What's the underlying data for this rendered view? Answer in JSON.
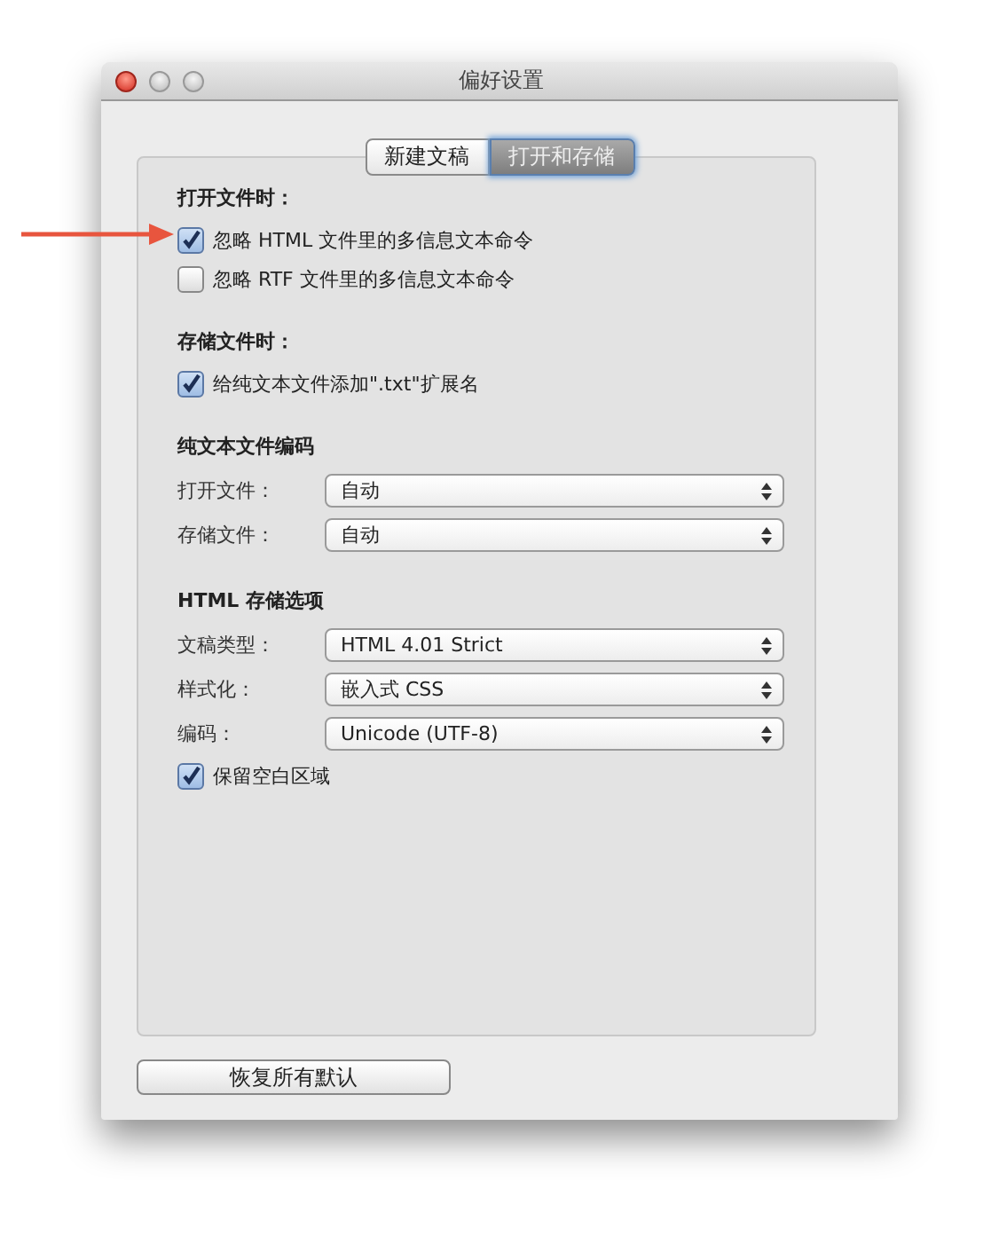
{
  "window": {
    "title": "偏好设置"
  },
  "tabs": [
    {
      "label": "新建文稿",
      "selected": false
    },
    {
      "label": "打开和存储",
      "selected": true
    }
  ],
  "sections": [
    {
      "heading": "打开文件时：",
      "items": [
        {
          "kind": "checkbox",
          "label": "忽略 HTML 文件里的多信息文本命令",
          "checked": true
        },
        {
          "kind": "checkbox",
          "label": "忽略 RTF 文件里的多信息文本命令",
          "checked": false
        }
      ]
    },
    {
      "heading": "存储文件时：",
      "items": [
        {
          "kind": "checkbox",
          "label": "给纯文本文件添加\".txt\"扩展名",
          "checked": true
        }
      ]
    },
    {
      "heading": "纯文本文件编码",
      "items": [
        {
          "kind": "select",
          "label": "打开文件：",
          "value": "自动"
        },
        {
          "kind": "select",
          "label": "存储文件：",
          "value": "自动"
        }
      ]
    },
    {
      "heading": "HTML 存储选项",
      "items": [
        {
          "kind": "select",
          "label": "文稿类型：",
          "value": "HTML 4.01 Strict"
        },
        {
          "kind": "select",
          "label": "样式化：",
          "value": "嵌入式 CSS"
        },
        {
          "kind": "select",
          "label": "编码：",
          "value": "Unicode (UTF-8)"
        },
        {
          "kind": "checkbox",
          "label": "保留空白区域",
          "checked": true
        }
      ]
    }
  ],
  "buttons": [
    {
      "label": "恢复所有默认"
    }
  ]
}
